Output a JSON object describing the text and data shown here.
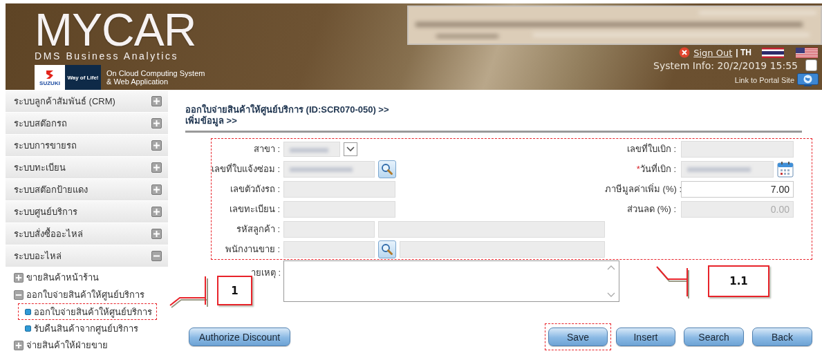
{
  "header": {
    "logo_title": "MYCAR",
    "logo_subtitle": "DMS Business Analytics",
    "brand_mark": "SUZUKI",
    "brand_slogan": "Way of Life!",
    "tagline": [
      "On Cloud Computing System",
      "& Web Application"
    ],
    "info_panel": {
      "redacted": true
    },
    "sign_out": "Sign Out",
    "language": "| TH",
    "system_info": "System Info: 20/2/2019 15:55",
    "checkbox": {
      "checked": false
    },
    "portal_link": "Link to Portal Site"
  },
  "sidebar": {
    "items": [
      {
        "label": "ระบบลูกค้าสัมพันธ์ (CRM)",
        "expanded": false
      },
      {
        "label": "ระบบสต๊อกรถ",
        "expanded": false
      },
      {
        "label": "ระบบการขายรถ",
        "expanded": false
      },
      {
        "label": "ระบบทะเบียน",
        "expanded": false
      },
      {
        "label": "ระบบสต๊อกป้ายแดง",
        "expanded": false
      },
      {
        "label": "ระบบศูนย์บริการ",
        "expanded": false
      },
      {
        "label": "ระบบสั่งซื้ออะไหล่",
        "expanded": false
      },
      {
        "label": "ระบบอะไหล่",
        "expanded": true,
        "children": [
          {
            "label": "ขายสินค้าหน้าร้าน",
            "expanded": false
          },
          {
            "label": "ออกใบจ่ายสินค้าให้ศูนย์บริการ",
            "expanded": true,
            "children": [
              {
                "label": "ออกใบจ่ายสินค้าให้ศูนย์บริการ",
                "highlighted": true
              },
              {
                "label": "รับคืนสินค้าจากศูนย์บริการ",
                "highlighted": false
              }
            ]
          },
          {
            "label": "จ่ายสินค้าให้ฝ่ายขาย",
            "expanded": false
          }
        ]
      }
    ]
  },
  "page_title": [
    "ออกใบจ่ายสินค้าให้ศูนย์บริการ (ID:SCR070-050) >>",
    "เพิ่มข้อมูล >>"
  ],
  "form": {
    "highlighted": true,
    "rows": [
      {
        "label": "สาขา :",
        "fields": [
          {
            "kind": "select",
            "redacted": true
          },
          {
            "kind": "dropdown"
          }
        ],
        "right": {
          "label": "เลขที่ใบเบิก :",
          "fields": [
            {
              "kind": "input",
              "disabled": true
            }
          ]
        }
      },
      {
        "label": "เลขที่ใบแจ้งซ่อม :",
        "fields": [
          {
            "kind": "input",
            "disabled": true,
            "redacted": true
          },
          {
            "kind": "search"
          }
        ],
        "right": {
          "required_mark": "*",
          "label": "วันที่เบิก :",
          "fields": [
            {
              "kind": "input",
              "disabled": true,
              "redacted": true
            },
            {
              "kind": "calendar"
            }
          ]
        }
      },
      {
        "label": "เลขตัวถังรถ :",
        "fields": [
          {
            "kind": "input",
            "disabled": true
          }
        ],
        "right": {
          "label": "ภาษีมูลค่าเพิ่ม (%) :",
          "fields": [
            {
              "kind": "input",
              "disabled": false,
              "value": "7.00"
            }
          ]
        }
      },
      {
        "label": "เลขทะเบียน :",
        "fields": [
          {
            "kind": "input",
            "disabled": true
          }
        ],
        "right": {
          "label": "ส่วนลด (%) :",
          "fields": [
            {
              "kind": "input",
              "disabled": true,
              "value": "0.00"
            }
          ]
        }
      },
      {
        "label": "รหัสลูกค้า :",
        "fields": [
          {
            "kind": "input",
            "disabled": true
          },
          {
            "kind": "input",
            "disabled": true
          }
        ]
      },
      {
        "label": "พนักงานขาย :",
        "fields": [
          {
            "kind": "input",
            "disabled": true
          },
          {
            "kind": "search"
          },
          {
            "kind": "input",
            "disabled": true
          }
        ]
      }
    ]
  },
  "remark": {
    "label": "ายเหตุ :"
  },
  "buttons": [
    {
      "label": "Authorize Discount",
      "highlighted": false
    },
    {
      "label": "Save",
      "highlighted": true
    },
    {
      "label": "Insert",
      "highlighted": false
    },
    {
      "label": "Search",
      "highlighted": false
    },
    {
      "label": "Back",
      "highlighted": false
    }
  ],
  "callouts": [
    {
      "label": "1"
    },
    {
      "label": "1.1"
    }
  ]
}
